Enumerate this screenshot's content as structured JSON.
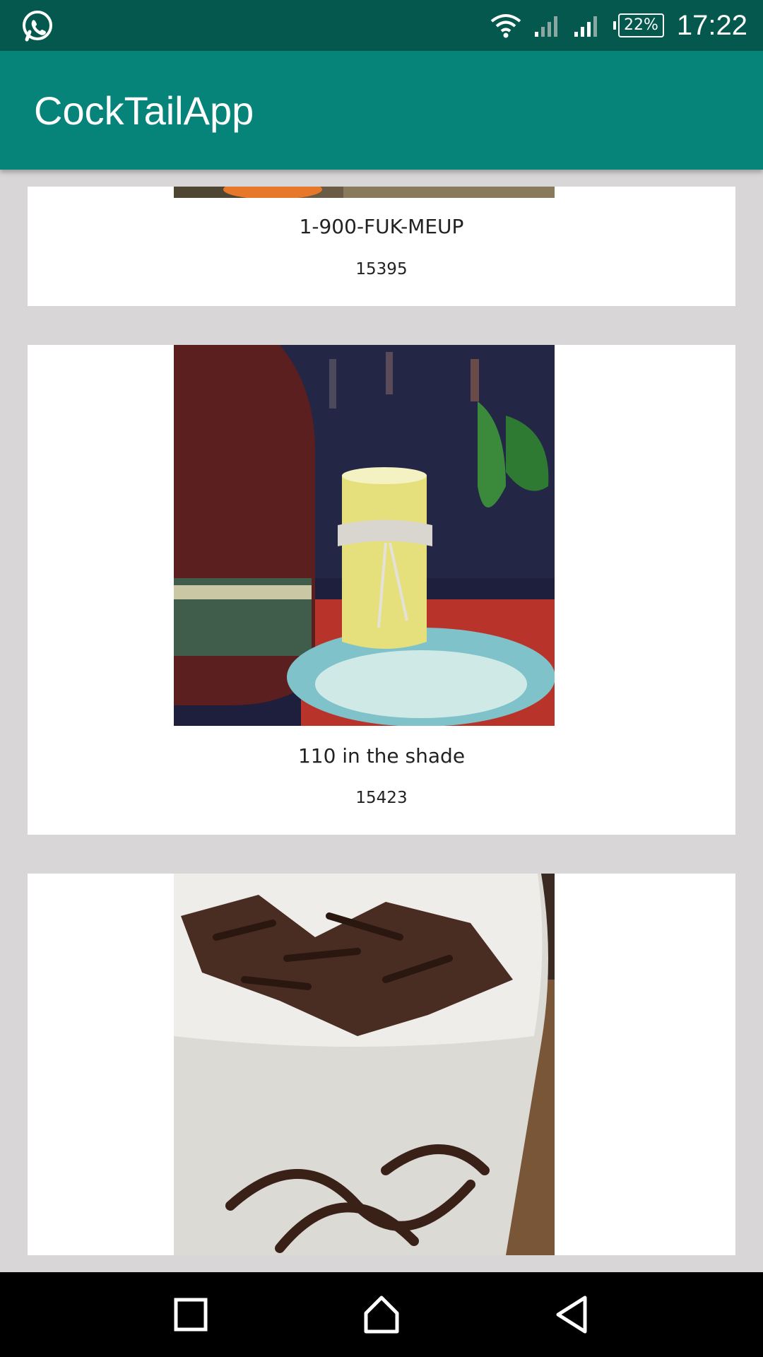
{
  "status_bar": {
    "battery_percent": "22%",
    "time": "17:22",
    "icons": [
      "whatsapp-icon",
      "wifi-icon",
      "signal-icon",
      "signal-icon",
      "battery-icon"
    ]
  },
  "app_bar": {
    "title": "CockTailApp"
  },
  "cocktails": [
    {
      "name": "1-900-FUK-MEUP",
      "id": "15395"
    },
    {
      "name": "110 in the shade",
      "id": "15423"
    },
    {
      "name": "",
      "id": ""
    }
  ],
  "nav_bar": {
    "icons": [
      "recents-icon",
      "home-icon",
      "back-icon"
    ]
  },
  "colors": {
    "status_bar": "#05584d",
    "app_bar": "#078479",
    "list_background": "#d8d6d6",
    "card_background": "#ffffff"
  }
}
